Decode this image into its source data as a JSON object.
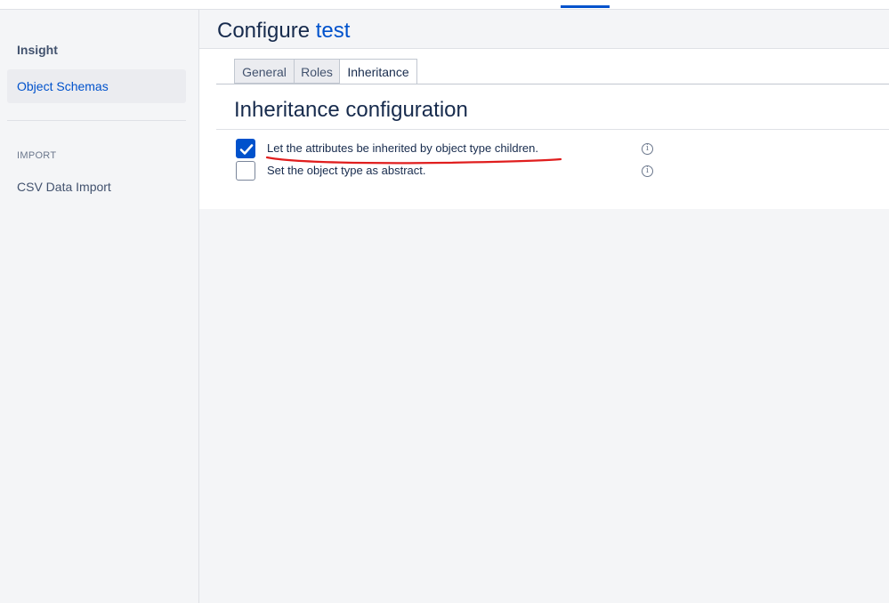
{
  "header": {
    "title_prefix": "Configure",
    "title_object": "test"
  },
  "sidebar": {
    "title": "Insight",
    "active_item": "Object Schemas",
    "section_label": "IMPORT",
    "link": "CSV Data Import"
  },
  "tabs": [
    {
      "label": "General"
    },
    {
      "label": "Roles"
    },
    {
      "label": "Inheritance",
      "active": true
    }
  ],
  "section": {
    "title": "Inheritance configuration",
    "options": [
      {
        "label": "Let the attributes be inherited by object type children.",
        "checked": true,
        "info_icon": "info-icon"
      },
      {
        "label": "Set the object type as abstract.",
        "checked": false,
        "info_icon": "info-icon"
      }
    ]
  },
  "annotation": {
    "color": "#e01e1e",
    "icon": "underline-scribble"
  },
  "colors": {
    "accent": "#0052cc",
    "checkbox_checked": "#0052cc"
  }
}
